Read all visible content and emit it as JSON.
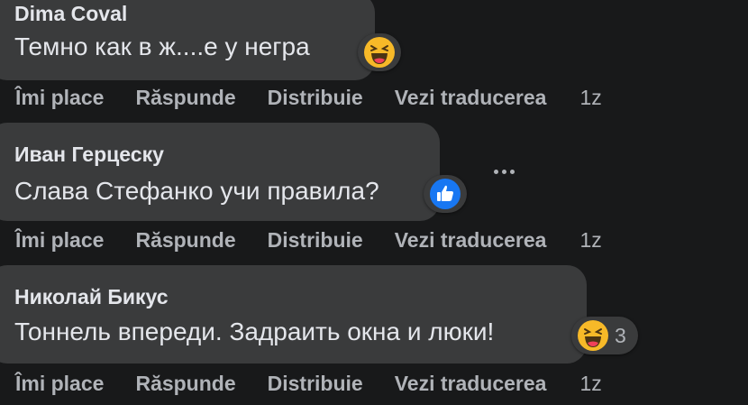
{
  "comments": [
    {
      "author": "Dima Coval",
      "text": "Темно как в ж....е у негра",
      "reaction": "haha",
      "reaction_count": "",
      "actions": {
        "like": "Îmi place",
        "reply": "Răspunde",
        "share": "Distribuie",
        "translate": "Vezi traducerea",
        "time": "1z"
      }
    },
    {
      "author": "Иван Герцеску",
      "text": "Слава Стефанко учи правила?",
      "reaction": "like",
      "reaction_count": "",
      "actions": {
        "like": "Îmi place",
        "reply": "Răspunde",
        "share": "Distribuie",
        "translate": "Vezi traducerea",
        "time": "1z"
      }
    },
    {
      "author": "Николай Бикус",
      "text": "Тоннель впереди. Задраить окна и люки!",
      "reaction": "haha",
      "reaction_count": "3",
      "actions": {
        "like": "Îmi place",
        "reply": "Răspunde",
        "share": "Distribuie",
        "translate": "Vezi traducerea",
        "time": "1z"
      }
    }
  ],
  "colors": {
    "background": "#18191a",
    "bubble": "#3a3b3c",
    "text": "#e4e6eb",
    "muted": "#b0b3b8",
    "like_blue": "#1877f2",
    "haha_yellow": "#f7b928"
  },
  "icons": {
    "more": "ellipsis-icon",
    "haha": "haha-reaction-icon",
    "like": "like-reaction-icon"
  }
}
